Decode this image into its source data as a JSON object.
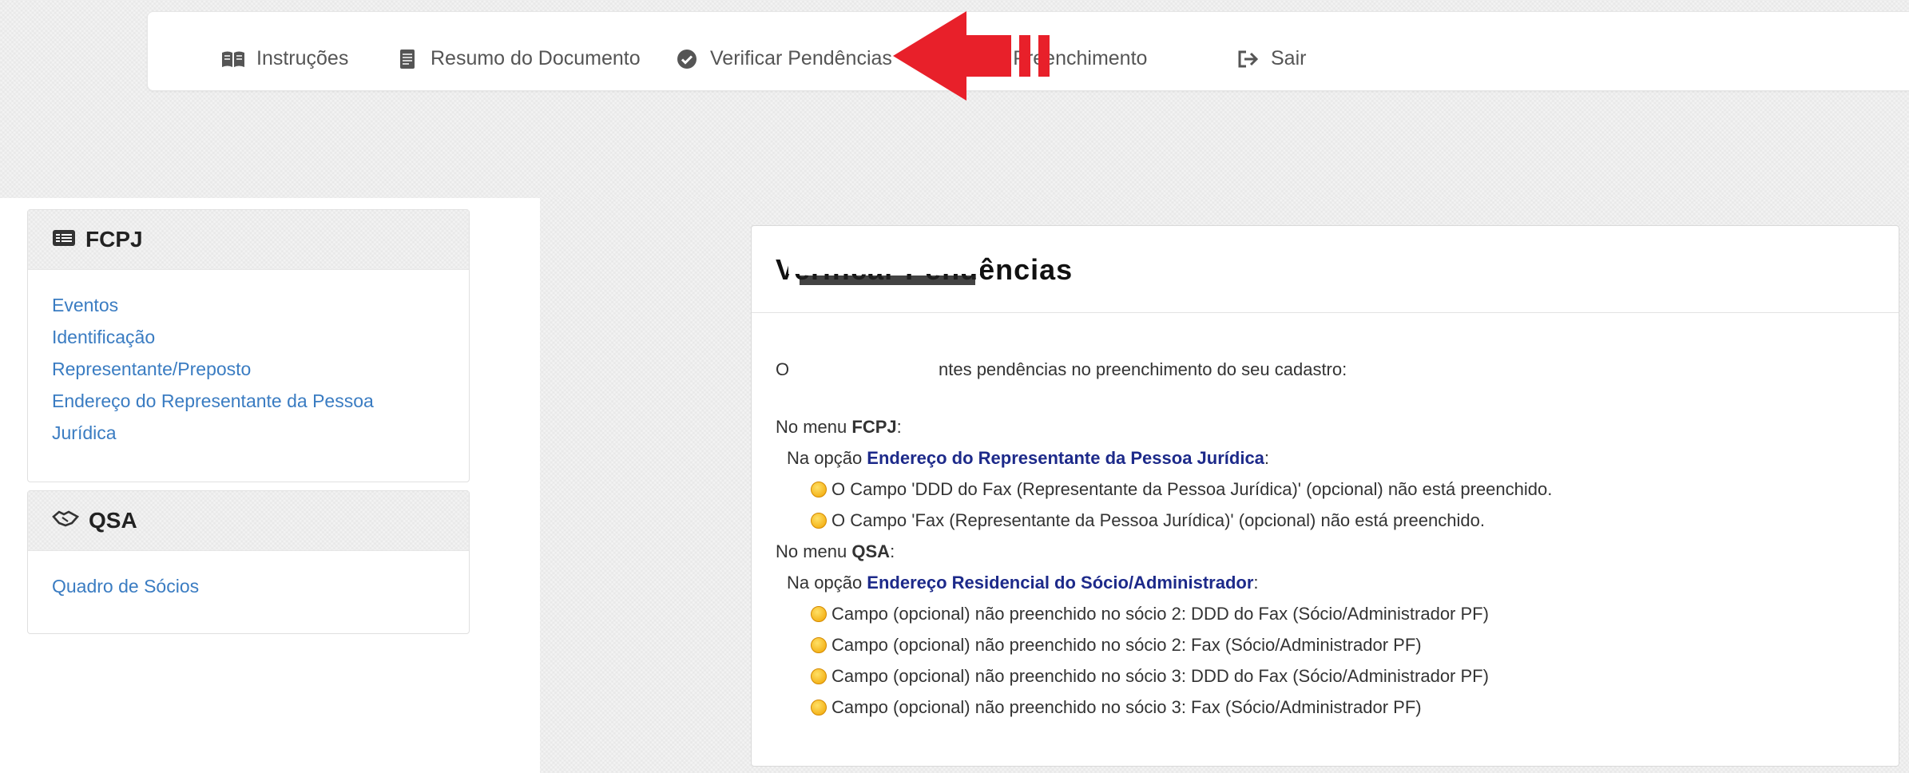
{
  "nav": {
    "items": [
      {
        "label": "Instruções",
        "icon": "book-icon"
      },
      {
        "label": "Resumo do Documento",
        "icon": "document-icon"
      },
      {
        "label": "Verificar Pendências",
        "icon": "check-circle-icon"
      },
      {
        "label": "r Preenchimento",
        "icon": "none"
      },
      {
        "label": "Sair",
        "icon": "logout-icon"
      }
    ]
  },
  "sidebar": {
    "fcpj": {
      "title": "FCPJ",
      "links": [
        "Eventos",
        "Identificação",
        "Representante/Preposto",
        "Endereço do Representante da Pessoa Jurídica"
      ]
    },
    "qsa": {
      "title": "QSA",
      "links": [
        "Quadro de Sócios"
      ]
    }
  },
  "main": {
    "title": "Verificar Pendências",
    "intro_start": "O",
    "intro_end": "ntes pendências no preenchimento do seu cadastro:",
    "menu_prefix": "No menu ",
    "option_prefix": "Na opção ",
    "groups": [
      {
        "menu": "FCPJ",
        "option": "Endereço do Representante da Pessoa Jurídica",
        "items": [
          "O Campo 'DDD do Fax (Representante da Pessoa Jurídica)' (opcional) não está preenchido.",
          "O Campo 'Fax (Representante da Pessoa Jurídica)' (opcional) não está preenchido."
        ]
      },
      {
        "menu": "QSA",
        "option": "Endereço Residencial do Sócio/Administrador",
        "items": [
          "Campo (opcional) não preenchido no sócio 2: DDD do Fax (Sócio/Administrador PF)",
          "Campo (opcional) não preenchido no sócio 2: Fax (Sócio/Administrador PF)",
          "Campo (opcional) não preenchido no sócio 3: DDD do Fax (Sócio/Administrador PF)",
          "Campo (opcional) não preenchido no sócio 3: Fax (Sócio/Administrador PF)"
        ]
      }
    ]
  },
  "colors": {
    "link": "#3a7cc2",
    "option": "#1d2a8a",
    "arrow": "#e8202a",
    "warning_dot": "#f0a400"
  }
}
